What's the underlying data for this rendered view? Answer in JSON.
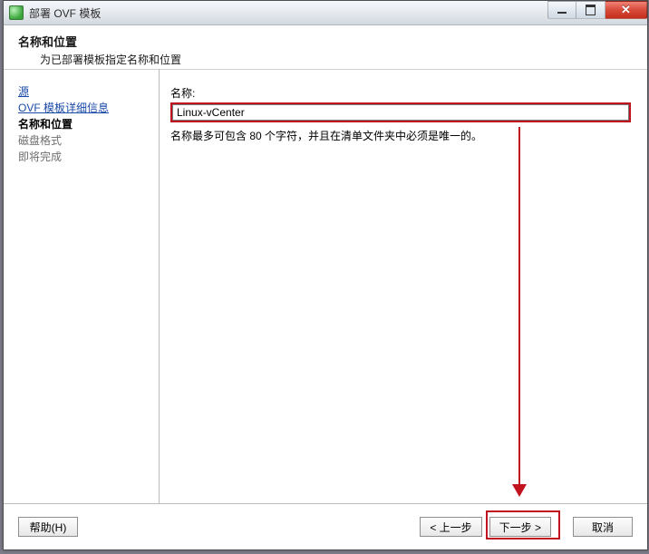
{
  "window": {
    "title": "部署 OVF 模板"
  },
  "header": {
    "title": "名称和位置",
    "subtitle": "为已部署模板指定名称和位置"
  },
  "sidebar": {
    "items": [
      {
        "label": "源",
        "state": "link"
      },
      {
        "label": "OVF 模板详细信息",
        "state": "link"
      },
      {
        "label": "名称和位置",
        "state": "current"
      },
      {
        "label": "磁盘格式",
        "state": "disabled"
      },
      {
        "label": "即将完成",
        "state": "disabled"
      }
    ]
  },
  "content": {
    "name_label": "名称:",
    "name_value": "Linux-vCenter",
    "name_hint": "名称最多可包含 80 个字符，并且在清单文件夹中必须是唯一的。"
  },
  "footer": {
    "help": "帮助(H)",
    "back": "< 上一步",
    "next": "下一步 >",
    "cancel": "取消"
  },
  "annotation": {
    "highlight_color": "#c1121f"
  }
}
